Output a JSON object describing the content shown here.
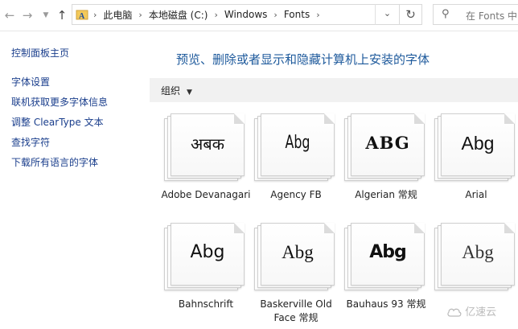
{
  "address_bar": {
    "back_icon": "arrow-left-icon",
    "forward_icon": "arrow-right-icon",
    "recent_icon": "chevron-down-icon",
    "up_icon": "arrow-up-icon",
    "crumbs": [
      "此电脑",
      "本地磁盘 (C:)",
      "Windows",
      "Fonts"
    ],
    "refresh_icon": "refresh-icon",
    "search_placeholder": "在 Fonts 中"
  },
  "left_pane": {
    "home_link": "控制面板主页",
    "links": [
      "字体设置",
      "联机获取更多字体信息",
      "调整 ClearType 文本",
      "查找字符",
      "下载所有语言的字体"
    ]
  },
  "main": {
    "title": "预览、删除或者显示和隐藏计算机上安装的字体",
    "toolbar": {
      "organize_label": "组织",
      "organize_caret": "▼"
    },
    "fonts": [
      {
        "sample": "अबक",
        "name": "Adobe Devanagari"
      },
      {
        "sample": "Abg",
        "name": "Agency FB"
      },
      {
        "sample": "ABG",
        "name": "Algerian 常规"
      },
      {
        "sample": "Abg",
        "name": "Arial"
      },
      {
        "sample": "Abg",
        "name": "Bahnschrift"
      },
      {
        "sample": "Abg",
        "name": "Baskerville Old Face 常规"
      },
      {
        "sample": "Abg",
        "name": "Bauhaus 93 常规"
      },
      {
        "sample": "Abg",
        "name": ""
      }
    ]
  },
  "watermark": "亿速云"
}
